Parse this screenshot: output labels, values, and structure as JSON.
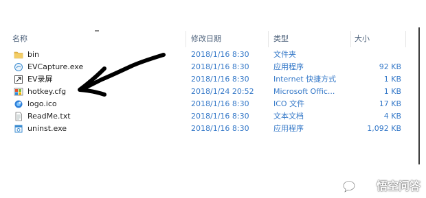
{
  "columns": {
    "name": "名称",
    "date": "修改日期",
    "type": "类型",
    "size": "大小"
  },
  "files": [
    {
      "name": "bin",
      "date": "2018/1/16 8:30",
      "type": "文件夹",
      "size": "",
      "icon": "folder-icon"
    },
    {
      "name": "EVCapture.exe",
      "date": "2018/1/16 8:30",
      "type": "应用程序",
      "size": "92 KB",
      "icon": "app-exe-icon"
    },
    {
      "name": "EV录屏",
      "date": "2018/1/16 8:30",
      "type": "Internet 快捷方式",
      "size": "1 KB",
      "icon": "internet-shortcut-icon"
    },
    {
      "name": "hotkey.cfg",
      "date": "2018/1/24 20:52",
      "type": "Microsoft Offic...",
      "size": "1 KB",
      "icon": "config-file-icon"
    },
    {
      "name": "logo.ico",
      "date": "2018/1/16 8:30",
      "type": "ICO 文件",
      "size": "17 KB",
      "icon": "ico-file-icon"
    },
    {
      "name": "ReadMe.txt",
      "date": "2018/1/16 8:30",
      "type": "文本文档",
      "size": "4 KB",
      "icon": "text-file-icon"
    },
    {
      "name": "uninst.exe",
      "date": "2018/1/16 8:30",
      "type": "应用程序",
      "size": "1,092 KB",
      "icon": "uninstaller-icon"
    }
  ],
  "annotation": {
    "points_to": "hotkey.cfg",
    "icon": "hand-drawn-arrow-icon"
  },
  "watermark": {
    "text": "悟空问答",
    "icon": "chat-bubble-icon"
  }
}
